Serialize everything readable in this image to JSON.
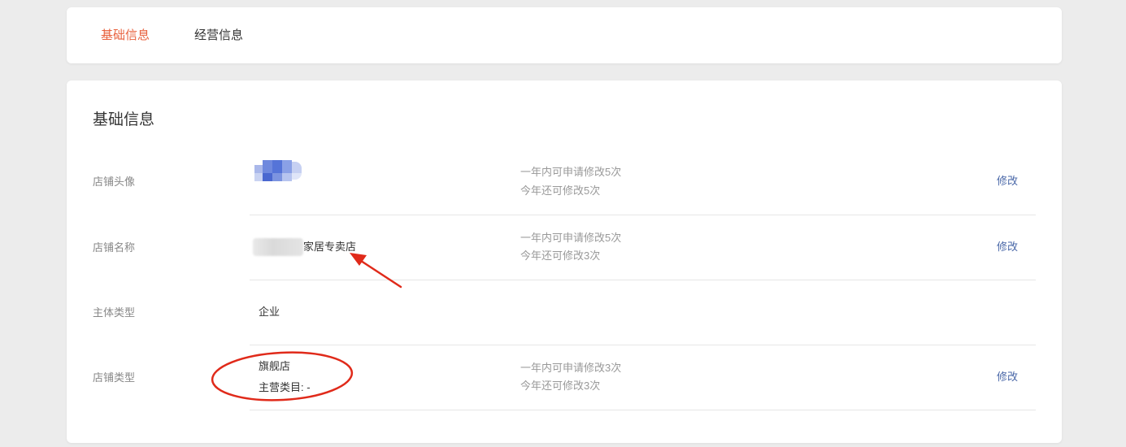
{
  "tabs": [
    {
      "label": "基础信息",
      "active": true
    },
    {
      "label": "经营信息",
      "active": false
    }
  ],
  "section": {
    "title": "基础信息"
  },
  "rows": [
    {
      "label": "店铺头像",
      "value": "",
      "hint1": "一年内可申请修改5次",
      "hint2": "今年还可修改5次",
      "action": "修改"
    },
    {
      "label": "店铺名称",
      "value": "家居专卖店",
      "hint1": "一年内可申请修改5次",
      "hint2": "今年还可修改3次",
      "action": "修改"
    },
    {
      "label": "主体类型",
      "value": "企业"
    },
    {
      "label": "店铺类型",
      "value": "旗舰店",
      "sub": "主营类目: -",
      "hint1": "一年内可申请修改3次",
      "hint2": "今年还可修改3次",
      "action": "修改"
    }
  ],
  "colors": {
    "accent": "#e8613d",
    "link": "#4a68a8",
    "annotation": "#e02a1a"
  }
}
